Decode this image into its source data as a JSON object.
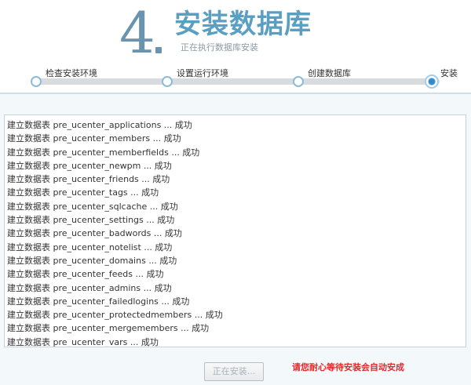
{
  "header": {
    "step_number": "4",
    "title": "安装数据库",
    "subtitle": "正在执行数据库安装"
  },
  "progress": {
    "steps": [
      {
        "label": "检查安装环境",
        "status": "done"
      },
      {
        "label": "设置运行环境",
        "status": "done"
      },
      {
        "label": "创建数据库",
        "status": "done"
      },
      {
        "label": "安装",
        "status": "current"
      }
    ]
  },
  "log": {
    "lines": [
      "建立数据表 pre_ucenter_applications ... 成功",
      "建立数据表 pre_ucenter_members ... 成功",
      "建立数据表 pre_ucenter_memberfields ... 成功",
      "建立数据表 pre_ucenter_newpm ... 成功",
      "建立数据表 pre_ucenter_friends ... 成功",
      "建立数据表 pre_ucenter_tags ... 成功",
      "建立数据表 pre_ucenter_sqlcache ... 成功",
      "建立数据表 pre_ucenter_settings ... 成功",
      "建立数据表 pre_ucenter_badwords ... 成功",
      "建立数据表 pre_ucenter_notelist ... 成功",
      "建立数据表 pre_ucenter_domains ... 成功",
      "建立数据表 pre_ucenter_feeds ... 成功",
      "建立数据表 pre_ucenter_admins ... 成功",
      "建立数据表 pre_ucenter_failedlogins ... 成功",
      "建立数据表 pre_ucenter_protectedmembers ... 成功",
      "建立数据表 pre_ucenter_mergemembers ... 成功",
      "建立数据表 pre_ucenter_vars ... 成功"
    ]
  },
  "footer": {
    "button_label": "正在安装...",
    "notice": "请您耐心等待安装会自动安成"
  },
  "colors": {
    "title": "#5a9fc1",
    "step_number": "#6a93b0",
    "notice": "#e02b2b",
    "progress_current": "#3c91cc"
  }
}
